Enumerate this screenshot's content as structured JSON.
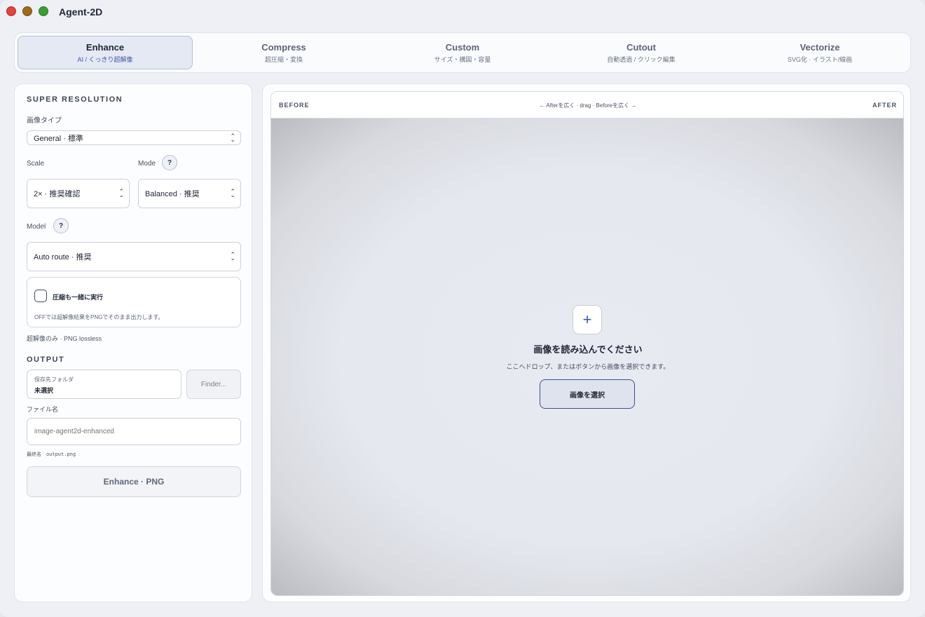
{
  "app": {
    "title": "Agent-2D"
  },
  "tabs": [
    {
      "label": "Enhance",
      "sub": "AI / くっきり超解像"
    },
    {
      "label": "Compress",
      "sub": "超圧縮・変換"
    },
    {
      "label": "Custom",
      "sub": "サイズ・構図・容量"
    },
    {
      "label": "Cutout",
      "sub": "自動透過 / クリック編集"
    },
    {
      "label": "Vectorize",
      "sub": "SVG化 · イラスト/線画"
    }
  ],
  "left": {
    "section_title": "SUPER RESOLUTION",
    "image_type_label": "画像タイプ",
    "image_type_value": "General · 標準",
    "scale_label": "Scale",
    "scale_value": "2× · 推奨確認",
    "mode_label": "Mode",
    "mode_value": "Balanced · 推奨",
    "help_glyph": "?",
    "model_label": "Model",
    "model_value": "Auto route · 推奨",
    "compress_checkbox_label": "圧縮も一緒に実行",
    "compress_note": "OFFでは超解像結果をPNGでそのまま出力します。",
    "output_mode_text": "超解像のみ · PNG lossless",
    "output_title": "OUTPUT",
    "folder_label": "保存先フォルダ",
    "folder_value": "未選択",
    "finder_button": "Finder...",
    "filename_label": "ファイル名",
    "filename_placeholder": "image-agent2d-enhanced",
    "final_name_label": "最終名",
    "final_name_value": "output.png",
    "run_button": "Enhance · PNG"
  },
  "compare": {
    "before_label": "BEFORE",
    "after_label": "AFTER",
    "hint": "← Afterを広く · drag · Beforeを広く →"
  },
  "empty": {
    "plus_glyph": "+",
    "title": "画像を読み込んでください",
    "subtitle": "ここへドロップ、またはボタンから画像を選択できます。",
    "choose_button": "画像を選択"
  }
}
